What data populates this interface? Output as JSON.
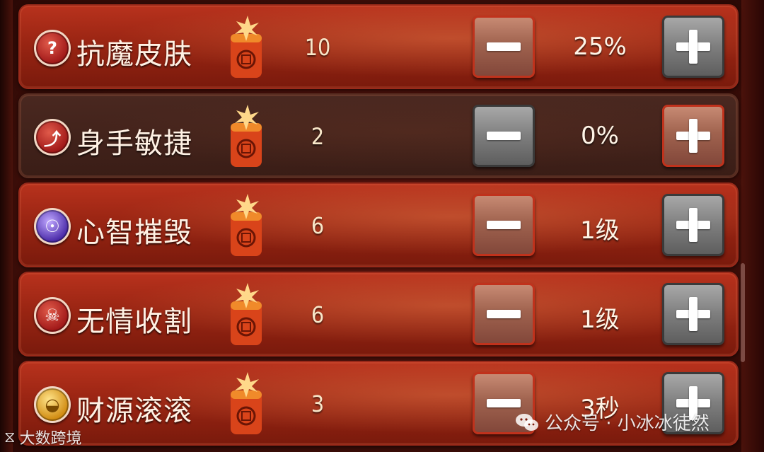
{
  "rows": [
    {
      "name": "抗魔皮肤",
      "icon": "shield-crest-icon",
      "count": "10",
      "value": "25%",
      "theme": "red",
      "minus_style": "brown",
      "plus_style": "grey"
    },
    {
      "name": "身手敏捷",
      "icon": "boot-icon",
      "count": "2",
      "value": "0%",
      "theme": "dark",
      "minus_style": "grey",
      "plus_style": "brown"
    },
    {
      "name": "心智摧毁",
      "icon": "brain-head-icon",
      "count": "6",
      "value": "1级",
      "theme": "red",
      "minus_style": "brown",
      "plus_style": "grey"
    },
    {
      "name": "无情收割",
      "icon": "reaper-icon",
      "count": "6",
      "value": "1级",
      "theme": "red",
      "minus_style": "brown",
      "plus_style": "grey"
    },
    {
      "name": "财源滚滚",
      "icon": "gold-ingot-icon",
      "count": "3",
      "value": "3秒",
      "theme": "red",
      "minus_style": "brown",
      "plus_style": "grey"
    }
  ],
  "watermark": {
    "left": "大数跨境",
    "right": "公众号 · 小冰冰徒然"
  },
  "colors": {
    "row_red": "#9a2513",
    "row_dark": "#3a1d16",
    "button_brown": "#a0634f",
    "button_grey": "#7e7e7e",
    "text": "#fff1e4"
  }
}
